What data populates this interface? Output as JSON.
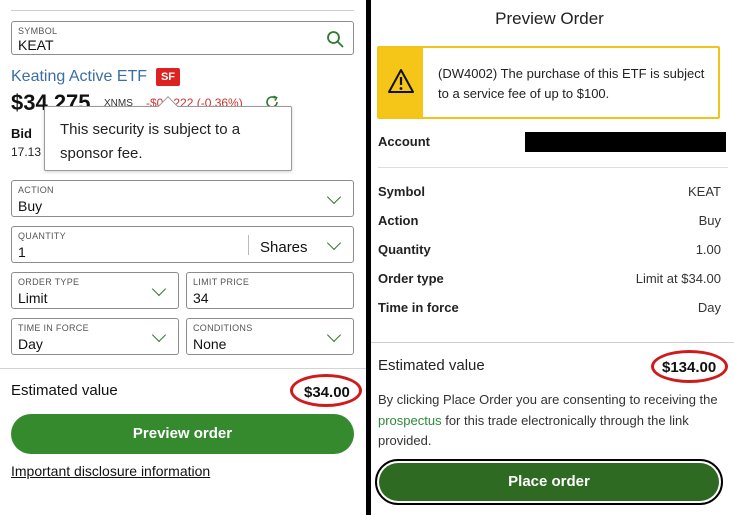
{
  "left": {
    "symbol": {
      "label": "SYMBOL",
      "value": "KEAT"
    },
    "security_name": "Keating Active ETF",
    "sf_badge": "SF",
    "price": "$34.275",
    "exchange": "XNMS",
    "change": "-$0.1222 (-0.36%)",
    "bid_label": "Bid",
    "bid_value": "17.13",
    "tooltip_text": "This security is subject to a sponsor fee.",
    "action": {
      "label": "ACTION",
      "value": "Buy"
    },
    "quantity": {
      "label": "QUANTITY",
      "value": "1",
      "unit": "Shares"
    },
    "order_type": {
      "label": "ORDER TYPE",
      "value": "Limit"
    },
    "limit_price": {
      "label": "LIMIT PRICE",
      "value": "34"
    },
    "time_in_force": {
      "label": "TIME IN FORCE",
      "value": "Day"
    },
    "conditions": {
      "label": "CONDITIONS",
      "value": "None"
    },
    "estimated_label": "Estimated value",
    "estimated_value": "$34.00",
    "preview_button": "Preview order",
    "disclosure_link": "Important disclosure information"
  },
  "right": {
    "title": "Preview Order",
    "alert_text": "(DW4002) The purchase of this ETF is subject to a service fee of up to $100.",
    "account_label": "Account",
    "rows": [
      {
        "label": "Symbol",
        "value": "KEAT"
      },
      {
        "label": "Action",
        "value": "Buy"
      },
      {
        "label": "Quantity",
        "value": "1.00"
      },
      {
        "label": "Order type",
        "value": "Limit at $34.00"
      },
      {
        "label": "Time in force",
        "value": "Day"
      }
    ],
    "estimated_label": "Estimated value",
    "estimated_value": "$134.00",
    "consent_before": "By clicking Place Order you are consenting to receiving the ",
    "consent_link": "prospectus",
    "consent_after": " for this trade electronically through the link provided.",
    "place_button": "Place order"
  },
  "colors": {
    "brand_green": "#368a2e",
    "place_green": "#2e6a22",
    "warning_yellow": "#f5c518",
    "annotation_red": "#d01b1b",
    "link_blue": "#3a6ea5"
  },
  "icons": [
    "search-icon",
    "refresh-icon",
    "chevron-down-icon",
    "warning-icon"
  ]
}
